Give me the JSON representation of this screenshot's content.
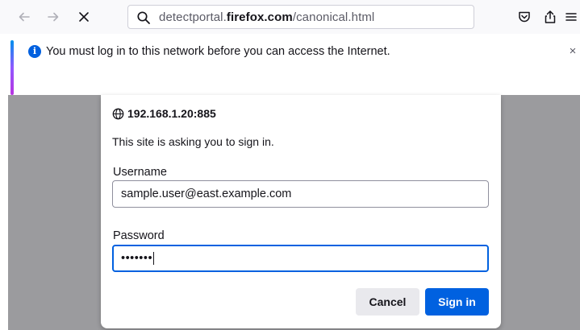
{
  "toolbar": {
    "back_icon": "arrow-left-icon",
    "forward_icon": "arrow-right-icon",
    "stop_icon": "close-icon",
    "url": {
      "prefix": "detectportal.",
      "domain": "firefox.com",
      "suffix": "/canonical.html"
    },
    "pocket_icon": "pocket-icon",
    "share_icon": "share-icon",
    "menu_icon": "hamburger-menu-icon"
  },
  "notification": {
    "icon": "info-icon",
    "text": "You must log in to this network before you can access the Internet.",
    "close_label": "×"
  },
  "dialog": {
    "origin": "192.168.1.20:885",
    "prompt": "This site is asking you to sign in.",
    "username_label": "Username",
    "username_value": "sample.user@east.example.com",
    "password_label": "Password",
    "password_mask": "•••••••",
    "cancel_label": "Cancel",
    "signin_label": "Sign in"
  },
  "colors": {
    "accent_blue": "#0061e0",
    "info_blue": "#0060df",
    "backdrop_gray": "#9b9b9e"
  }
}
